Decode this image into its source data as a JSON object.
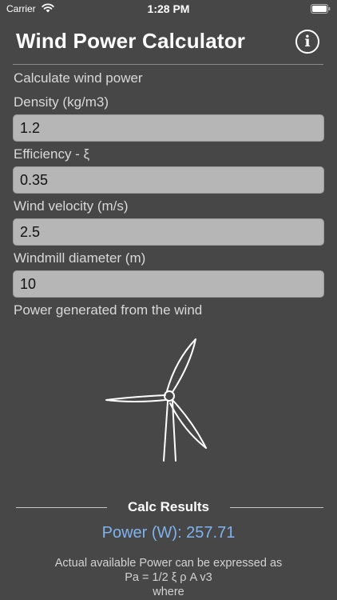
{
  "status_bar": {
    "carrier": "Carrier",
    "time": "1:28 PM"
  },
  "header": {
    "title": "Wind Power Calculator",
    "info_icon": "info-icon"
  },
  "form": {
    "intro": "Calculate wind power",
    "density": {
      "label": "Density (kg/m3)",
      "value": "1.2"
    },
    "efficiency": {
      "label": "Efficiency - ξ",
      "value": "0.35"
    },
    "wind_velocity": {
      "label": "Wind velocity (m/s)",
      "value": "2.5"
    },
    "diameter": {
      "label": "Windmill diameter (m)",
      "value": "10"
    },
    "power_label": "Power generated from the wind"
  },
  "illustration": {
    "icon": "wind-turbine-icon"
  },
  "results": {
    "title": "Calc Results",
    "power": "Power (W): 257.71",
    "explanation_line1": "Actual available Power can be expressed as",
    "explanation_line2": "Pa = 1/2 ξ ρ A v3",
    "explanation_line3": "where"
  },
  "colors": {
    "background": "#474747",
    "field_background": "#b6b6b6",
    "result_accent": "#7fb3ef"
  }
}
